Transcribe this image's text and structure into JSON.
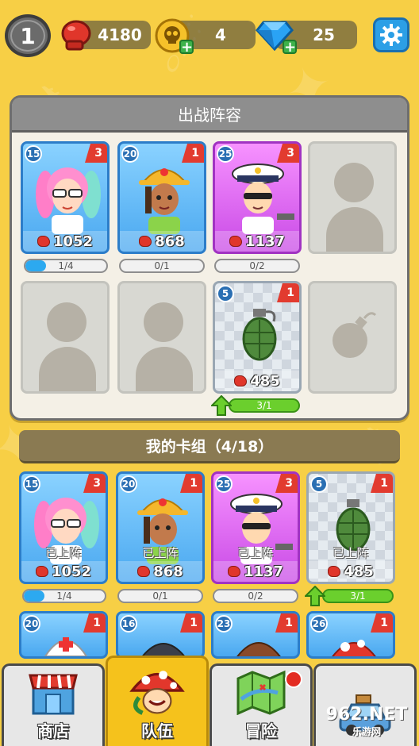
{
  "player": {
    "level": "1"
  },
  "resources": {
    "power": "4180",
    "skull": "4",
    "gems": "25"
  },
  "lineup": {
    "title": "出战阵容",
    "slots": [
      {
        "level": "15",
        "rank": "3",
        "power": "1052",
        "progress": "1/4",
        "progress_fraction": 0.25
      },
      {
        "level": "20",
        "rank": "1",
        "power": "868",
        "progress": "0/1",
        "progress_fraction": 0
      },
      {
        "level": "25",
        "rank": "3",
        "power": "1137",
        "progress": "0/2",
        "progress_fraction": 0
      },
      {
        "level": "5",
        "rank": "1",
        "power": "485",
        "progress": "3/1",
        "progress_fraction": 1
      }
    ]
  },
  "deck": {
    "title": "我的卡组（4/18）",
    "deployed_label": "已上阵",
    "cards": [
      {
        "level": "15",
        "rank": "3",
        "power": "1052",
        "progress": "1/4",
        "progress_fraction": 0.25
      },
      {
        "level": "20",
        "rank": "1",
        "power": "868",
        "progress": "0/1",
        "progress_fraction": 0
      },
      {
        "level": "25",
        "rank": "3",
        "power": "1137",
        "progress": "0/2",
        "progress_fraction": 0
      },
      {
        "level": "5",
        "rank": "1",
        "power": "485",
        "progress": "3/1",
        "progress_fraction": 1
      }
    ],
    "more_cards": [
      {
        "level": "20",
        "rank": "1"
      },
      {
        "level": "16",
        "rank": "1"
      },
      {
        "level": "23",
        "rank": "1"
      },
      {
        "level": "26",
        "rank": "1"
      }
    ]
  },
  "nav": {
    "shop": "商店",
    "team": "队伍",
    "adventure": "冒险"
  },
  "watermark": {
    "brand": "962.NET",
    "sub": "乐游网"
  },
  "colors": {
    "background": "#f7cf45",
    "blue_card": "#4aa8f0",
    "pink_card": "#c94be6",
    "rank_red": "#e23b2f",
    "progress_blue": "#2ca9f0",
    "progress_green": "#6bcf2d"
  }
}
